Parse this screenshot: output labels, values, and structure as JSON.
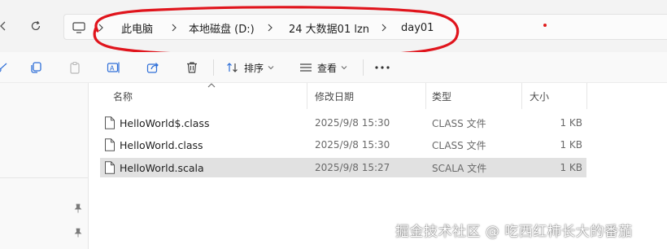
{
  "address_bar": {
    "path": [
      "此电脑",
      "本地磁盘 (D:)",
      "24 大数据01 lzn",
      "day01"
    ]
  },
  "icons": {
    "back": "chevron-left-icon",
    "refresh": "refresh-icon",
    "computer": "computer-icon",
    "separator": "chevron-right-icon",
    "cut": "cut-icon",
    "copy": "copy-icon",
    "paste": "paste-icon",
    "rename": "rename-icon",
    "share": "share-icon",
    "delete": "trash-icon",
    "sort": "sort-icon",
    "view": "view-icon",
    "more": "more-icon",
    "pin": "pin-icon",
    "file": "file-icon"
  },
  "toolbar": {
    "sort_label": "排序",
    "view_label": "查看"
  },
  "file_list": {
    "columns": {
      "name": "名称",
      "modified": "修改日期",
      "type": "类型",
      "size": "大小"
    },
    "files": [
      {
        "name": "HelloWorld$.class",
        "modified": "2025/9/8 15:30",
        "type": "CLASS 文件",
        "size": "1 KB"
      },
      {
        "name": "HelloWorld.class",
        "modified": "2025/9/8 15:30",
        "type": "CLASS 文件",
        "size": "1 KB"
      },
      {
        "name": "HelloWorld.scala",
        "modified": "2025/9/8 15:27",
        "type": "SCALA 文件",
        "size": "1 KB"
      }
    ],
    "selected_index": 2
  },
  "annotation": {
    "highlight_color": "#e0141c"
  },
  "watermark": "掘金技术社区 @ 吃西红柿长大的番茄"
}
